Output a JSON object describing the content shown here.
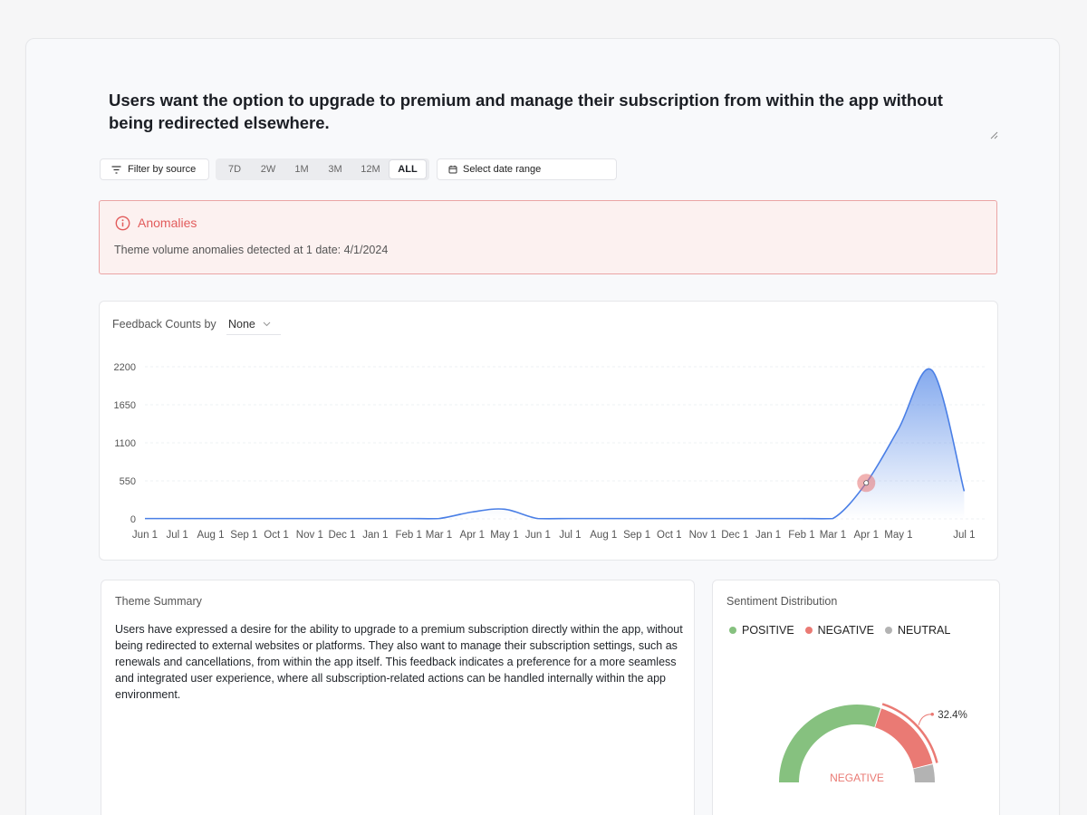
{
  "theme": {
    "title": "Users want the option to upgrade to premium and manage their subscription from within the app without being redirected elsewhere."
  },
  "toolbar": {
    "filter_label": "Filter by source",
    "ranges": [
      "7D",
      "2W",
      "1M",
      "3M",
      "12M",
      "ALL"
    ],
    "active_range": "ALL",
    "date_placeholder": "Select date range"
  },
  "anomalies": {
    "title": "Anomalies",
    "message": "Theme volume anomalies detected at 1 date: 4/1/2024",
    "color": "#e25c5c"
  },
  "feedback_chart": {
    "label": "Feedback Counts by",
    "group_by": "None"
  },
  "chart_data": {
    "type": "area",
    "title": "",
    "xlabel": "",
    "ylabel": "",
    "ylim": [
      0,
      2200
    ],
    "yticks": [
      0,
      550,
      1100,
      1650,
      2200
    ],
    "x_tick_labels": [
      "Jun 1",
      "Jul 1",
      "Aug 1",
      "Sep 1",
      "Oct 1",
      "Nov 1",
      "Dec 1",
      "Jan 1",
      "Feb 1",
      "Mar 1",
      "Apr 1",
      "May 1",
      "Jun 1",
      "Jul 1",
      "Aug 1",
      "Sep 1",
      "Oct 1",
      "Nov 1",
      "Dec 1",
      "Jan 1",
      "Feb 1",
      "Mar 1",
      "Apr 1",
      "May 1",
      "Jul 1"
    ],
    "x": [
      "2022-06-01",
      "2022-07-01",
      "2022-08-01",
      "2022-09-01",
      "2022-10-01",
      "2022-11-01",
      "2022-12-01",
      "2023-01-01",
      "2023-02-01",
      "2023-03-01",
      "2023-04-01",
      "2023-05-01",
      "2023-06-01",
      "2023-07-01",
      "2023-08-01",
      "2023-09-01",
      "2023-10-01",
      "2023-11-01",
      "2023-12-01",
      "2024-01-01",
      "2024-02-01",
      "2024-03-01",
      "2024-04-01",
      "2024-05-01",
      "2024-06-01",
      "2024-07-01"
    ],
    "series": [
      {
        "values": [
          5,
          5,
          5,
          5,
          5,
          5,
          5,
          5,
          5,
          5,
          100,
          140,
          5,
          5,
          5,
          5,
          5,
          5,
          5,
          5,
          5,
          5,
          520,
          1300,
          2150,
          400
        ],
        "color": "#4a7fe6"
      }
    ],
    "anomaly": {
      "x": "2024-04-01",
      "y": 520,
      "color": "#e57373"
    },
    "grid": true
  },
  "summary": {
    "title": "Theme Summary",
    "text": "Users have expressed a desire for the ability to upgrade to a premium subscription directly within the app, without being redirected to external websites or platforms. They also want to manage their subscription settings, such as renewals and cancellations, from within the app itself. This feedback indicates a preference for a more seamless and integrated user experience, where all subscription-related actions can be handled internally within the app environment."
  },
  "sentiment": {
    "title": "Sentiment Distribution",
    "legend": [
      {
        "label": "POSITIVE",
        "color": "#86c17f"
      },
      {
        "label": "NEGATIVE",
        "color": "#ea7a74"
      },
      {
        "label": "NEUTRAL",
        "color": "#b3b3b3"
      }
    ],
    "highlight_label": "NEGATIVE",
    "highlight_value": "32.4%",
    "positive_fraction": 0.6,
    "negative_fraction": 0.324,
    "neutral_fraction": 0.076
  }
}
